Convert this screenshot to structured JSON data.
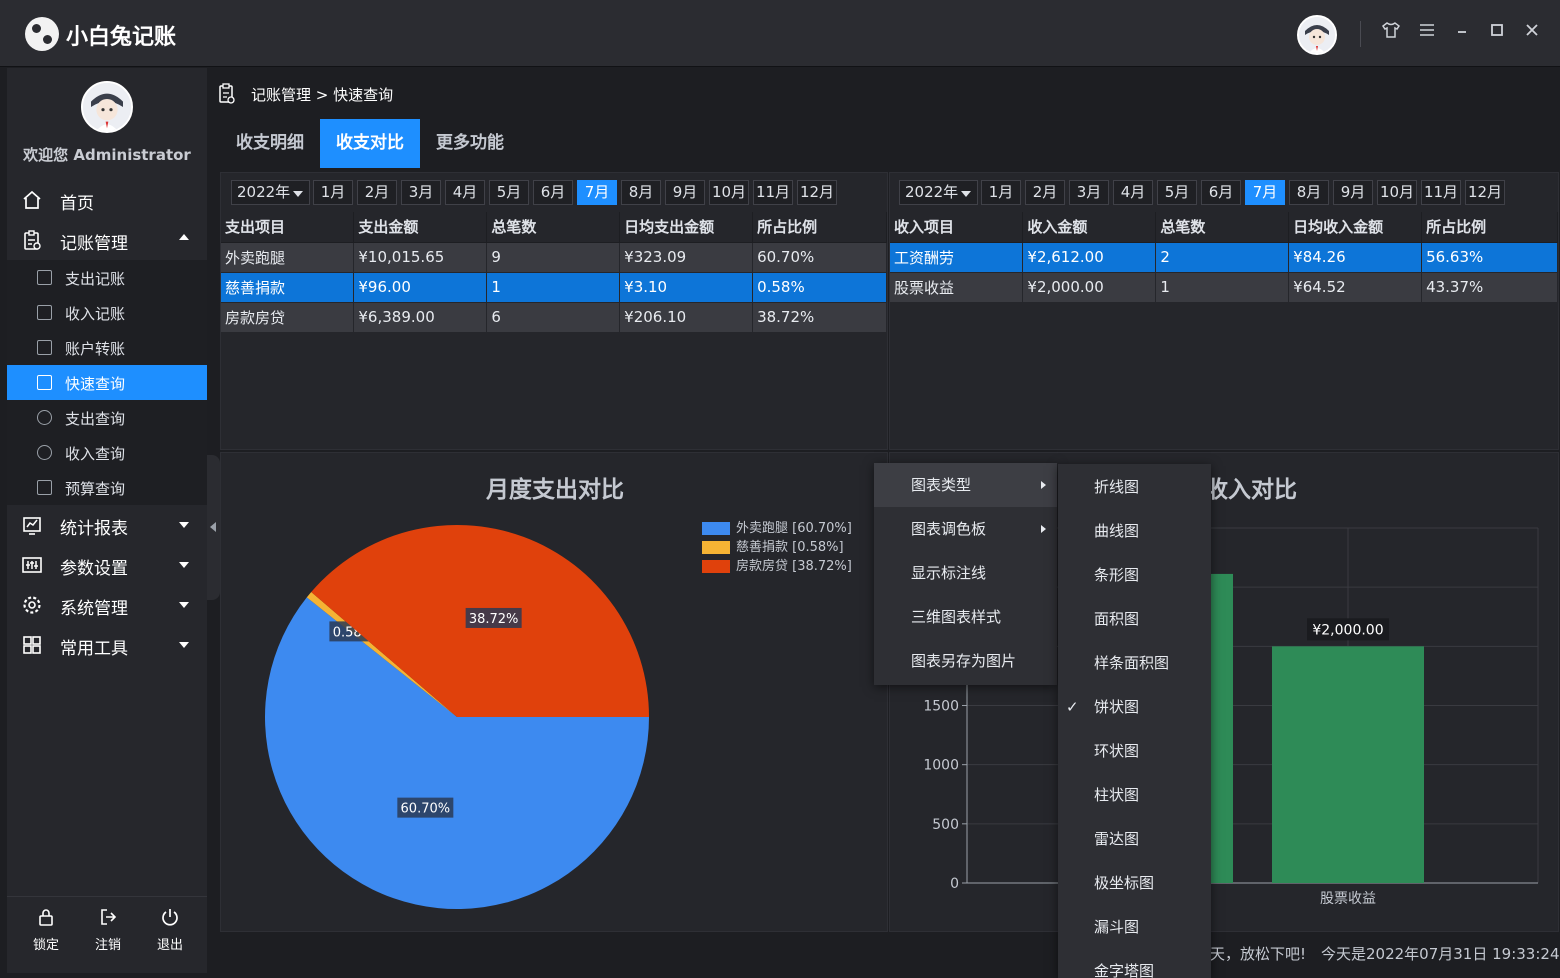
{
  "app": {
    "title": "小白兔记账"
  },
  "window_controls": [
    {
      "name": "skin-icon",
      "glyph": "👕"
    },
    {
      "name": "menu-icon",
      "glyph": "☰"
    },
    {
      "name": "minimize-icon",
      "glyph": "–"
    },
    {
      "name": "maximize-icon",
      "glyph": "□"
    },
    {
      "name": "close-icon",
      "glyph": "✕"
    }
  ],
  "sidebar": {
    "welcome": "欢迎您 Administrator",
    "nav": [
      {
        "label": "首页",
        "icon": "home-icon"
      },
      {
        "label": "记账管理",
        "icon": "clipboard-icon",
        "expanded": true
      },
      {
        "label": "统计报表",
        "icon": "chart-icon"
      },
      {
        "label": "参数设置",
        "icon": "sliders-icon"
      },
      {
        "label": "系统管理",
        "icon": "gear-icon"
      },
      {
        "label": "常用工具",
        "icon": "grid-icon"
      }
    ],
    "sub_items": [
      {
        "label": "支出记账"
      },
      {
        "label": "收入记账"
      },
      {
        "label": "账户转账"
      },
      {
        "label": "快速查询",
        "active": true
      },
      {
        "label": "支出查询"
      },
      {
        "label": "收入查询"
      },
      {
        "label": "预算查询"
      }
    ],
    "bottom": [
      {
        "label": "锁定",
        "icon": "lock-icon"
      },
      {
        "label": "注销",
        "icon": "logout-icon"
      },
      {
        "label": "退出",
        "icon": "power-icon"
      }
    ]
  },
  "breadcrumb": {
    "text": "记账管理 > 快速查询"
  },
  "tabs": [
    {
      "label": "收支明细"
    },
    {
      "label": "收支对比",
      "active": true
    },
    {
      "label": "更多功能"
    }
  ],
  "year": "2022年",
  "months": [
    "1月",
    "2月",
    "3月",
    "4月",
    "5月",
    "6月",
    "7月",
    "8月",
    "9月",
    "10月",
    "11月",
    "12月"
  ],
  "selected_month": "7月",
  "expense_table": {
    "headers": [
      "支出项目",
      "支出金额",
      "总笔数",
      "日均支出金额",
      "所占比例"
    ],
    "rows": [
      [
        "外卖跑腿",
        "¥10,015.65",
        "9",
        "¥323.09",
        "60.70%"
      ],
      [
        "慈善捐款",
        "¥96.00",
        "1",
        "¥3.10",
        "0.58%"
      ],
      [
        "房款房贷",
        "¥6,389.00",
        "6",
        "¥206.10",
        "38.72%"
      ]
    ],
    "selected_row": 1
  },
  "income_table": {
    "headers": [
      "收入项目",
      "收入金额",
      "总笔数",
      "日均收入金额",
      "所占比例"
    ],
    "rows": [
      [
        "工资酬劳",
        "¥2,612.00",
        "2",
        "¥84.26",
        "56.63%"
      ],
      [
        "股票收益",
        "¥2,000.00",
        "1",
        "¥64.52",
        "43.37%"
      ]
    ],
    "selected_row": 0
  },
  "chart_data": [
    {
      "type": "pie",
      "title": "月度支出对比",
      "categories": [
        "外卖跑腿",
        "慈善捐款",
        "房款房贷"
      ],
      "values": [
        60.7,
        0.58,
        38.72
      ],
      "labels": [
        "60.70%",
        "0.58%",
        "38.72%"
      ],
      "legend": [
        "外卖跑腿 [60.70%]",
        "慈善捐款 [0.58%]",
        "房款房贷 [38.72%]"
      ],
      "legend_position": "top-right",
      "colors": [
        "#3d8af0",
        "#f5b334",
        "#e0410c"
      ]
    },
    {
      "type": "bar",
      "title": "收入对比",
      "categories": [
        "工资酬劳",
        "股票收益"
      ],
      "values": [
        2612.0,
        2000.0
      ],
      "x_tick_labels_visible": [
        "股票收益"
      ],
      "y_ticks": [
        0,
        500,
        1000,
        1500
      ],
      "ylim": [
        0,
        3000
      ],
      "data_labels": [
        "",
        "¥2,000.00"
      ],
      "grid": true,
      "colors": [
        "#2e8b57"
      ]
    }
  ],
  "context_menu": {
    "items": [
      {
        "label": "图表类型",
        "submenu": true,
        "hover": true
      },
      {
        "label": "图表调色板",
        "submenu": true
      },
      {
        "label": "显示标注线"
      },
      {
        "label": "三维图表样式"
      },
      {
        "label": "图表另存为图片"
      }
    ],
    "chart_types": [
      {
        "label": "折线图"
      },
      {
        "label": "曲线图"
      },
      {
        "label": "条形图"
      },
      {
        "label": "面积图"
      },
      {
        "label": "样条面积图"
      },
      {
        "label": "饼状图",
        "checked": true
      },
      {
        "label": "环状图"
      },
      {
        "label": "柱状图"
      },
      {
        "label": "雷达图"
      },
      {
        "label": "极坐标图"
      },
      {
        "label": "漏斗图"
      },
      {
        "label": "金字塔图"
      }
    ],
    "check_mark": "✓"
  },
  "status": {
    "message": "天，放松下吧!",
    "datetime": "今天是2022年07月31日 19:33:24"
  },
  "colors": {
    "accent": "#1e8fff",
    "selected_row": "#0d75d8",
    "bar": "#2e8b57"
  }
}
